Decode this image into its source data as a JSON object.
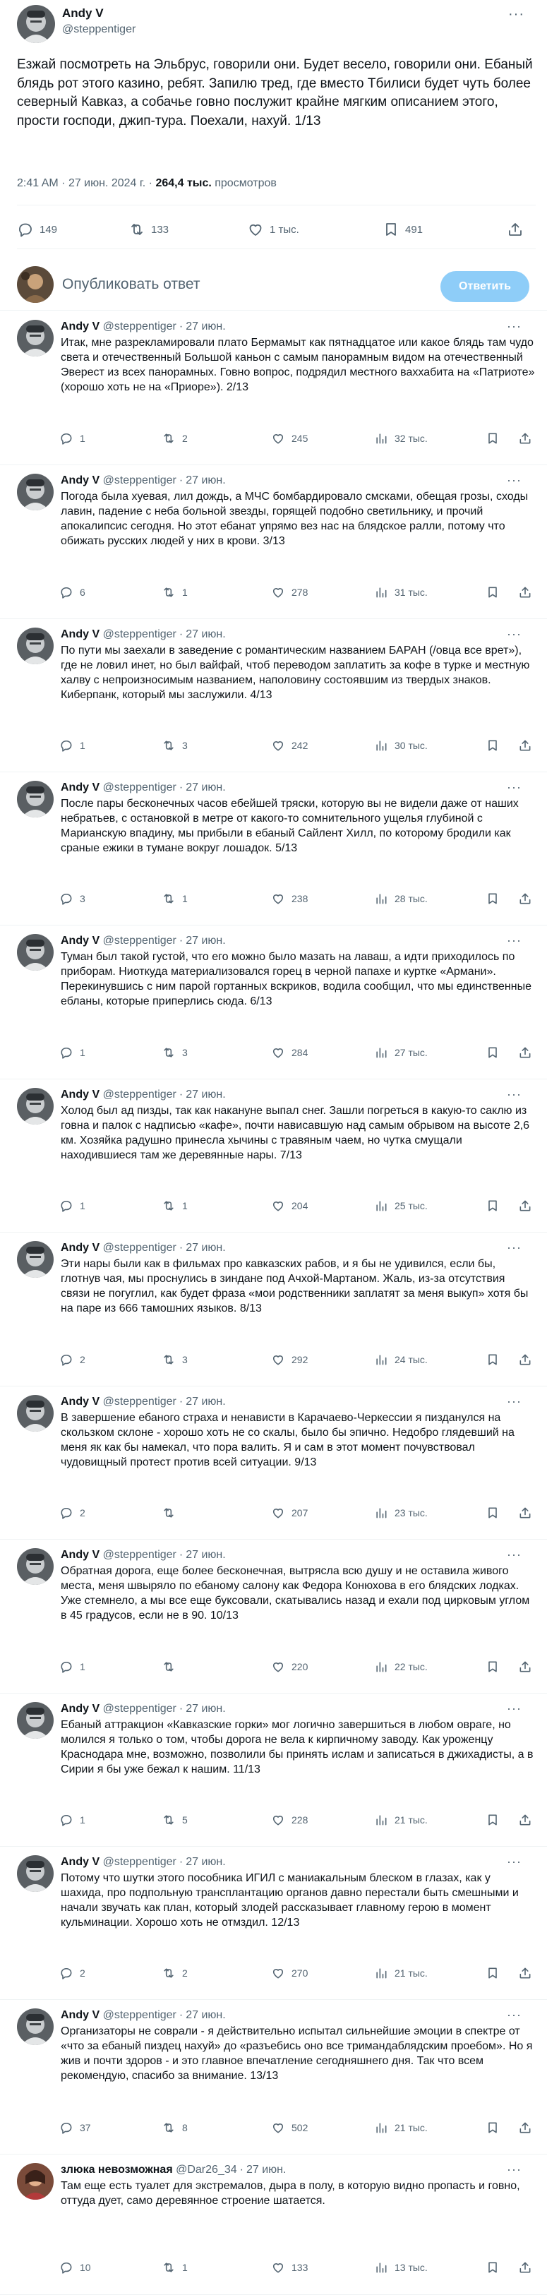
{
  "main_tweet": {
    "author_name": "Andy V",
    "author_handle": "@steppentiger",
    "text": "Езжай посмотреть на Эльбрус, говорили они. Будет весело, говорили они. Ебаный блядь рот этого казино, ребят. Запилю тред, где вместо Тбилиси будет чуть более северный Кавказ, а собачье говно послужит крайне мягким описанием этого, прости господи, джип-тура. Поехали, нахуй. 1/13",
    "time": "2:41 AM",
    "date": "27 июн. 2024 г.",
    "views_count": "264,4 тыс.",
    "views_label": "просмотров",
    "replies": "149",
    "retweets": "133",
    "likes": "1 тыс.",
    "bookmarks": "491",
    "separator": "·"
  },
  "composer": {
    "placeholder": "Опубликовать ответ",
    "button_label": "Ответить"
  },
  "replies": [
    {
      "name": "Andy V",
      "handle": "@steppentiger",
      "date": "27 июн.",
      "text": "Итак, мне разрекламировали плато Бермамыт как пятнадцатое или какое блядь там чудо света и отечественный Большой каньон с самым панорамным видом на отечественный Эверест из всех панорамных. Говно вопрос, подрядил местного ваххабита на «Патриоте» (хорошо хоть не на «Приоре»). 2/13",
      "replies": "1",
      "retweets": "2",
      "likes": "245",
      "views": "32 тыс."
    },
    {
      "name": "Andy V",
      "handle": "@steppentiger",
      "date": "27 июн.",
      "text": "Погода была хуевая, лил дождь, а МЧС бомбардировало смсками, обещая грозы, сходы лавин, падение с неба больной звезды, горящей подобно светильнику, и прочий апокалипсис сегодня. Но этот ебанат упрямо вез нас на блядское ралли, потому что обижать русских людей у них в крови. 3/13",
      "replies": "6",
      "retweets": "1",
      "likes": "278",
      "views": "31 тыс."
    },
    {
      "name": "Andy V",
      "handle": "@steppentiger",
      "date": "27 июн.",
      "text": "По пути мы заехали в заведение с романтическим названием БАРАН (/овца все врет»), где не ловил инет, но был вайфай, чтоб переводом заплатить за кофе в турке и местную халву с непроизносимым названием, наполовину состоявшим из твердых знаков. Киберпанк, который мы заслужили. 4/13",
      "replies": "1",
      "retweets": "3",
      "likes": "242",
      "views": "30 тыс."
    },
    {
      "name": "Andy V",
      "handle": "@steppentiger",
      "date": "27 июн.",
      "text": "После пары бесконечных часов ебейшей тряски, которую вы не видели даже от наших небратьев, с остановкой в метре от какого-то сомнительного ущелья глубиной с Марианскую впадину, мы прибыли в ебаный Сайлент Хилл, по которому бродили как сраные ежики в тумане вокруг лошадок. 5/13",
      "replies": "3",
      "retweets": "1",
      "likes": "238",
      "views": "28 тыс."
    },
    {
      "name": "Andy V",
      "handle": "@steppentiger",
      "date": "27 июн.",
      "text": "Туман был такой густой, что его можно было мазать на лаваш, а идти приходилось по приборам. Ниоткуда материализовался горец в черной папахе и куртке «Армани». Перекинувшись с ним парой гортанных вскриков, водила сообщил, что мы единственные ебланы, которые приперлись сюда. 6/13",
      "replies": "1",
      "retweets": "3",
      "likes": "284",
      "views": "27 тыс."
    },
    {
      "name": "Andy V",
      "handle": "@steppentiger",
      "date": "27 июн.",
      "text": "Холод был ад пизды, так как накануне выпал снег. Зашли погреться в какую-то саклю из говна и палок с надписью «кафе», почти нависавшую над самым обрывом на высоте 2,6 км. Хозяйка радушно принесла хычины с травяным чаем, но чутка смущали находившиеся там же деревянные нары. 7/13",
      "replies": "1",
      "retweets": "1",
      "likes": "204",
      "views": "25 тыс."
    },
    {
      "name": "Andy V",
      "handle": "@steppentiger",
      "date": "27 июн.",
      "text": "Эти нары были как в фильмах про кавказских рабов, и я бы не удивился, если бы, глотнув чая, мы проснулись в зиндане под Ачхой-Мартаном. Жаль, из-за отсутствия связи не погуглил, как будет фраза «мои родственники заплатят за меня выкуп» хотя бы на паре из 666 тамошних языков. 8/13",
      "replies": "2",
      "retweets": "3",
      "likes": "292",
      "views": "24 тыс."
    },
    {
      "name": "Andy V",
      "handle": "@steppentiger",
      "date": "27 июн.",
      "text": "В завершение ебаного страха и ненависти в Карачаево-Черкессии я пизданулся на скользком склоне - хорошо хоть не со скалы, было бы эпично. Недобро глядевший на меня як как бы намекал, что пора валить. Я и сам в этот момент почувствовал чудовищный протест против всей ситуации. 9/13",
      "replies": "2",
      "retweets": "",
      "likes": "207",
      "views": "23 тыс."
    },
    {
      "name": "Andy V",
      "handle": "@steppentiger",
      "date": "27 июн.",
      "text": "Обратная дорога, еще более бесконечная, вытрясла всю душу и не оставила живого места, меня швыряло по ебаному салону как Федора Конюхова в его блядских лодках. Уже стемнело, а мы все еще буксовали, скатывались назад и ехали под цирковым углом в 45 градусов, если не в 90. 10/13",
      "replies": "1",
      "retweets": "",
      "likes": "220",
      "views": "22 тыс."
    },
    {
      "name": "Andy V",
      "handle": "@steppentiger",
      "date": "27 июн.",
      "text": "Ебаный аттракцион «Кавказские горки» мог логично завершиться в любом овраге, но молился я только о том, чтобы дорога не вела к кирпичному заводу. Как уроженцу Краснодара мне, возможно, позволили бы принять ислам и записаться в джихадисты, а в Сирии я бы уже бежал к нашим. 11/13",
      "replies": "1",
      "retweets": "5",
      "likes": "228",
      "views": "21 тыс."
    },
    {
      "name": "Andy V",
      "handle": "@steppentiger",
      "date": "27 июн.",
      "text": "Потому что шутки этого пособника ИГИЛ с маниакальным блеском в глазах, как у шахида, про подпольную трансплантацию органов давно перестали быть смешными и начали звучать как план, который злодей рассказывает главному герою в момент кульминации. Хорошо хоть не отмздил. 12/13",
      "replies": "2",
      "retweets": "2",
      "likes": "270",
      "views": "21 тыс."
    },
    {
      "name": "Andy V",
      "handle": "@steppentiger",
      "date": "27 июн.",
      "text": "Организаторы не соврали - я действительно испытал сильнейшие эмоции в спектре от «что за ебаный пиздец нахуй» до «разъебись оно все тримандаблядским проебом». Но я жив и почти здоров - и это главное впечатление сегодняшнего дня. Так что всем рекомендую, спасибо за внимание. 13/13",
      "replies": "37",
      "retweets": "8",
      "likes": "502",
      "views": "21 тыс."
    },
    {
      "name": "злюка невозможная",
      "handle": "@Dar26_34",
      "date": "27 июн.",
      "text": "Там еще есть туалет для экстремалов, дыра в полу, в которую видно пропасть и говно, оттуда дует, само деревянное строение шатается.",
      "replies": "10",
      "retweets": "1",
      "likes": "133",
      "views": "13 тыс."
    }
  ],
  "icons": {
    "reply": "speech-bubble-icon",
    "retweet": "retweet-arrows-icon",
    "like": "heart-icon",
    "views": "bar-chart-icon",
    "bookmark": "bookmark-icon",
    "share": "share-upload-icon",
    "more": "ellipsis-icon"
  },
  "colors": {
    "text_primary": "#0f1419",
    "text_secondary": "#536471",
    "divider": "#eff3f4",
    "reply_button": "#8ecdf8"
  }
}
